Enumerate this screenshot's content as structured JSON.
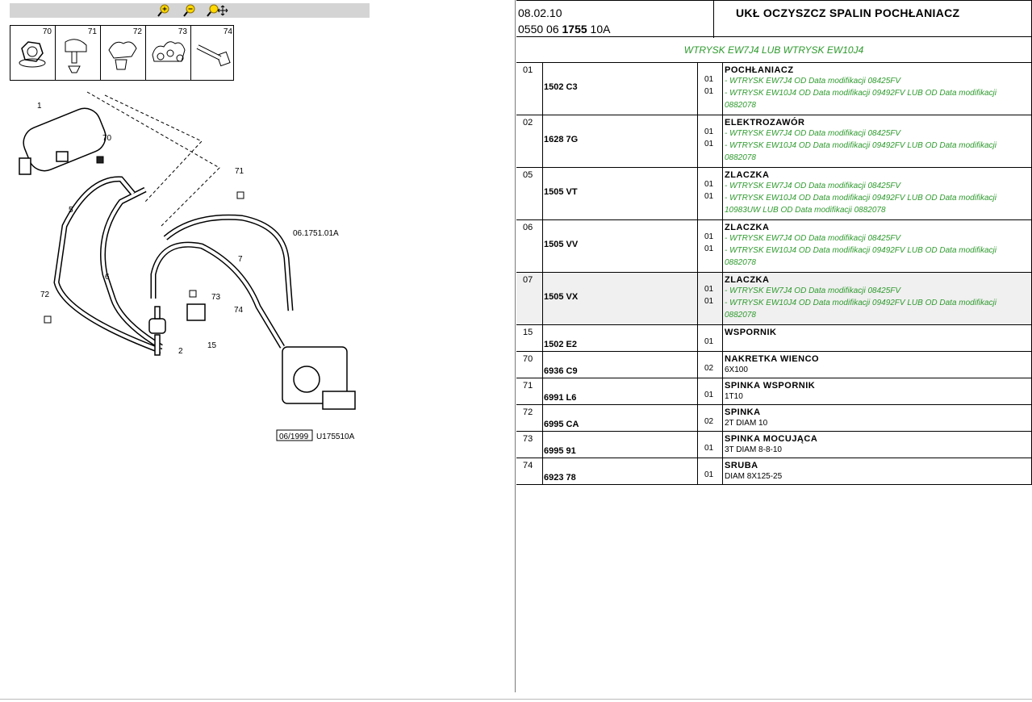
{
  "toolbar": {
    "zoom_in_icon": "zoom-in-icon",
    "zoom_out_icon": "zoom-out-icon",
    "zoom_fit_icon": "zoom-fit-icon"
  },
  "parts_strip": [
    {
      "num": "70"
    },
    {
      "num": "71"
    },
    {
      "num": "72"
    },
    {
      "num": "73"
    },
    {
      "num": "74"
    }
  ],
  "diagram": {
    "callouts": [
      "1",
      "70",
      "71",
      "5",
      "6",
      "06.1751.01A",
      "7",
      "72",
      "73",
      "74",
      "2",
      "15"
    ],
    "stamp_date": "06/1999",
    "stamp_code": "U175510A"
  },
  "header": {
    "date": "08.02.10",
    "ref_prefix": "0550 06",
    "ref_bold": "1755",
    "ref_suffix": "10A",
    "title": "UKŁ OCZYSZCZ SPALIN POCHŁANIACZ",
    "subtitle": "WTRYSK EW7J4 LUB WTRYSK EW10J4"
  },
  "colors": {
    "green_text": "#2e9a2e",
    "highlight_row": "#f0f0f0"
  },
  "rows": [
    {
      "item": "01",
      "code": "1502 C3",
      "name": "POCHŁANIACZ",
      "lines": [
        {
          "q": "01",
          "t": "- WTRYSK EW7J4 OD Data modifikacji 08425FV"
        },
        {
          "q": "01",
          "t": "- WTRYSK EW10J4 OD Data modifikacji 09492FV LUB OD Data modifikacji 0882078"
        }
      ]
    },
    {
      "item": "02",
      "code": "1628 7G",
      "name": "ELEKTROZAWÓR",
      "lines": [
        {
          "q": "01",
          "t": "- WTRYSK EW7J4 OD Data modifikacji 08425FV"
        },
        {
          "q": "01",
          "t": "- WTRYSK EW10J4 OD Data modifikacji 09492FV LUB OD Data modifikacji 0882078"
        }
      ]
    },
    {
      "item": "05",
      "code": "1505 VT",
      "name": "ZLACZKA",
      "lines": [
        {
          "q": "01",
          "t": "- WTRYSK EW7J4 OD Data modifikacji 08425FV"
        },
        {
          "q": "01",
          "t": "- WTRYSK EW10J4 OD Data modifikacji 09492FV LUB OD Data modifikacji 10983UW LUB OD Data modifikacji 0882078"
        }
      ]
    },
    {
      "item": "06",
      "code": "1505 VV",
      "name": "ZLACZKA",
      "lines": [
        {
          "q": "01",
          "t": "- WTRYSK EW7J4 OD Data modifikacji 08425FV"
        },
        {
          "q": "01",
          "t": "- WTRYSK EW10J4 OD Data modifikacji 09492FV LUB OD Data modifikacji 0882078"
        }
      ]
    },
    {
      "item": "07",
      "code": "1505 VX",
      "name": "ZLACZKA",
      "lines": [
        {
          "q": "01",
          "t": "- WTRYSK EW7J4 OD Data modifikacji 08425FV"
        },
        {
          "q": "01",
          "t": "- WTRYSK EW10J4 OD Data modifikacji 09492FV LUB OD Data modifikacji 0882078"
        }
      ]
    },
    {
      "item": "15",
      "code": "1502 E2",
      "name": "WSPORNIK",
      "lines": [
        {
          "q": "01",
          "t": ""
        }
      ]
    },
    {
      "item": "70",
      "code": "6936 C9",
      "name": "NAKRETKA WIENCO",
      "lines": [
        {
          "q": "02",
          "t": "6X100",
          "plain": true
        }
      ]
    },
    {
      "item": "71",
      "code": "6991 L6",
      "name": "SPINKA WSPORNIK",
      "lines": [
        {
          "q": "01",
          "t": "1T10",
          "plain": true
        }
      ]
    },
    {
      "item": "72",
      "code": "6995 CA",
      "name": "SPINKA",
      "lines": [
        {
          "q": "02",
          "t": "2T DIAM 10",
          "plain": true
        }
      ]
    },
    {
      "item": "73",
      "code": "6995 91",
      "name": "SPINKA MOCUJĄCA",
      "lines": [
        {
          "q": "01",
          "t": "3T DIAM 8-8-10",
          "plain": true
        }
      ]
    },
    {
      "item": "74",
      "code": "6923 78",
      "name": "SRUBA",
      "lines": [
        {
          "q": "01",
          "t": "DIAM 8X125-25",
          "plain": true
        }
      ]
    }
  ]
}
